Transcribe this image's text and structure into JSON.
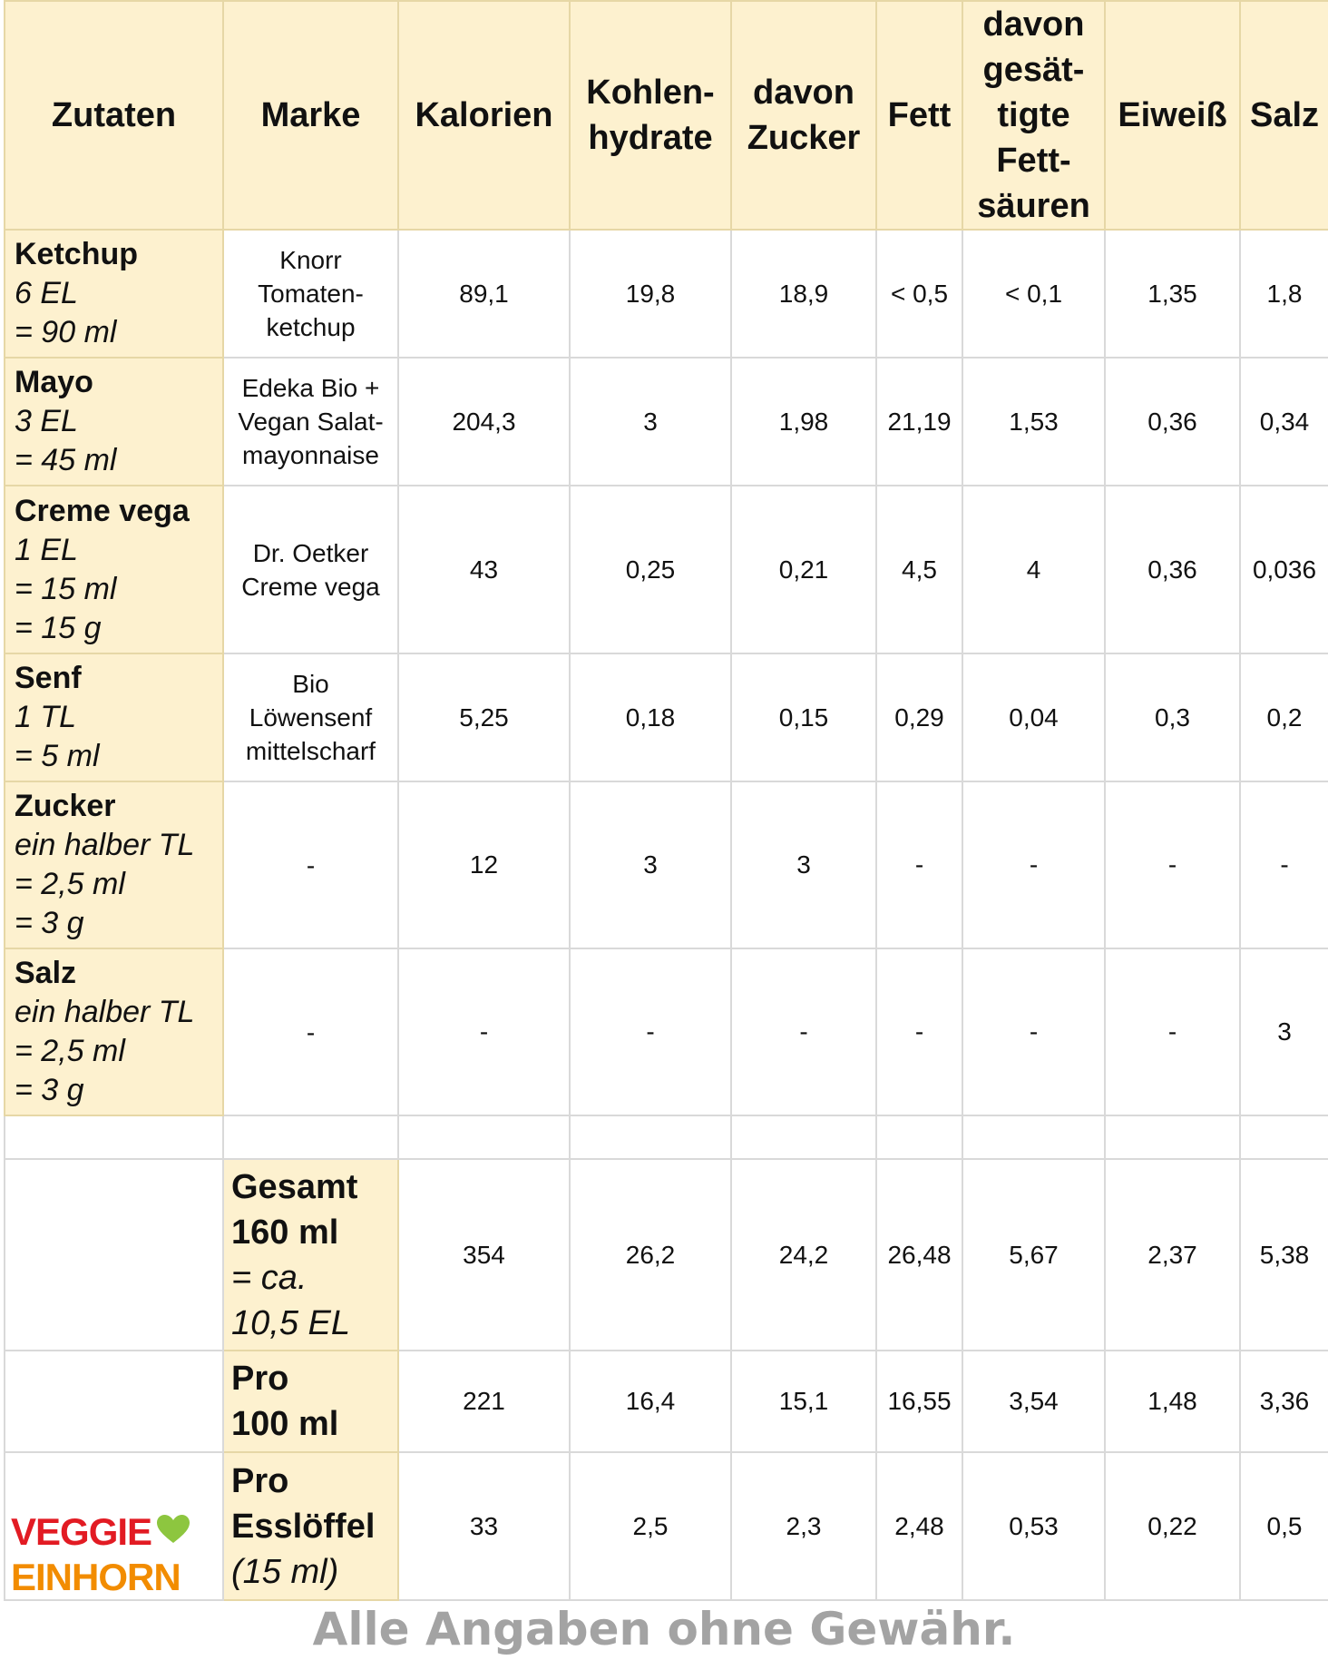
{
  "headers": [
    "Zutaten",
    "Marke",
    "Kalorien",
    "Kohlen-\nhydrate",
    "davon\nZucker",
    "Fett",
    "davon\ngesät-\ntigte\nFett-\nsäuren",
    "Eiweiß",
    "Salz"
  ],
  "ingredients": [
    {
      "name": "Ketchup",
      "amount": "6 EL\n= 90 ml",
      "brand": "Knorr\nTomaten-\nketchup",
      "values": [
        "89,1",
        "19,8",
        "18,9",
        "< 0,5",
        "< 0,1",
        "1,35",
        "1,8"
      ]
    },
    {
      "name": "Mayo",
      "amount": "3 EL\n= 45 ml",
      "brand": "Edeka Bio +\nVegan Salat-\nmayonnaise",
      "values": [
        "204,3",
        "3",
        "1,98",
        "21,19",
        "1,53",
        "0,36",
        "0,34"
      ]
    },
    {
      "name": "Creme vega",
      "amount": "1 EL\n= 15 ml\n= 15 g",
      "brand": "Dr. Oetker\nCreme vega",
      "values": [
        "43",
        "0,25",
        "0,21",
        "4,5",
        "4",
        "0,36",
        "0,036"
      ]
    },
    {
      "name": "Senf",
      "amount": "1 TL\n= 5 ml",
      "brand": "Bio\nLöwensenf\nmittelscharf",
      "values": [
        "5,25",
        "0,18",
        "0,15",
        "0,29",
        "0,04",
        "0,3",
        "0,2"
      ]
    },
    {
      "name": "Zucker",
      "amount": "ein halber TL\n= 2,5 ml\n= 3 g",
      "brand": "-",
      "values": [
        "12",
        "3",
        "3",
        "-",
        "-",
        "-",
        "-"
      ]
    },
    {
      "name": "Salz",
      "amount": "ein halber TL\n= 2,5 ml\n= 3 g",
      "brand": "-",
      "values": [
        "-",
        "-",
        "-",
        "-",
        "-",
        "-",
        "3"
      ]
    }
  ],
  "summary": [
    {
      "label": "Gesamt\n160 ml",
      "sub": "= ca.\n10,5 EL",
      "values": [
        "354",
        "26,2",
        "24,2",
        "26,48",
        "5,67",
        "2,37",
        "5,38"
      ]
    },
    {
      "label": "Pro\n100 ml",
      "sub": "",
      "values": [
        "221",
        "16,4",
        "15,1",
        "16,55",
        "3,54",
        "1,48",
        "3,36"
      ]
    },
    {
      "label": "Pro\nEsslöffel",
      "sub": "(15 ml)",
      "values": [
        "33",
        "2,5",
        "2,3",
        "2,48",
        "0,53",
        "0,22",
        "0,5"
      ]
    }
  ],
  "logo": {
    "line1": "VEGGIE",
    "line2": "EINHORN",
    "colors": {
      "red": "#e21b23",
      "orange": "#f28c00",
      "green": "#8dc63f"
    }
  },
  "disclaimer": "Alle Angaben ohne Gewähr.",
  "colors": {
    "header_bg": "#fdf1cf",
    "grid": "#d9d9d9",
    "disclaimer": "#a3a3a3"
  }
}
